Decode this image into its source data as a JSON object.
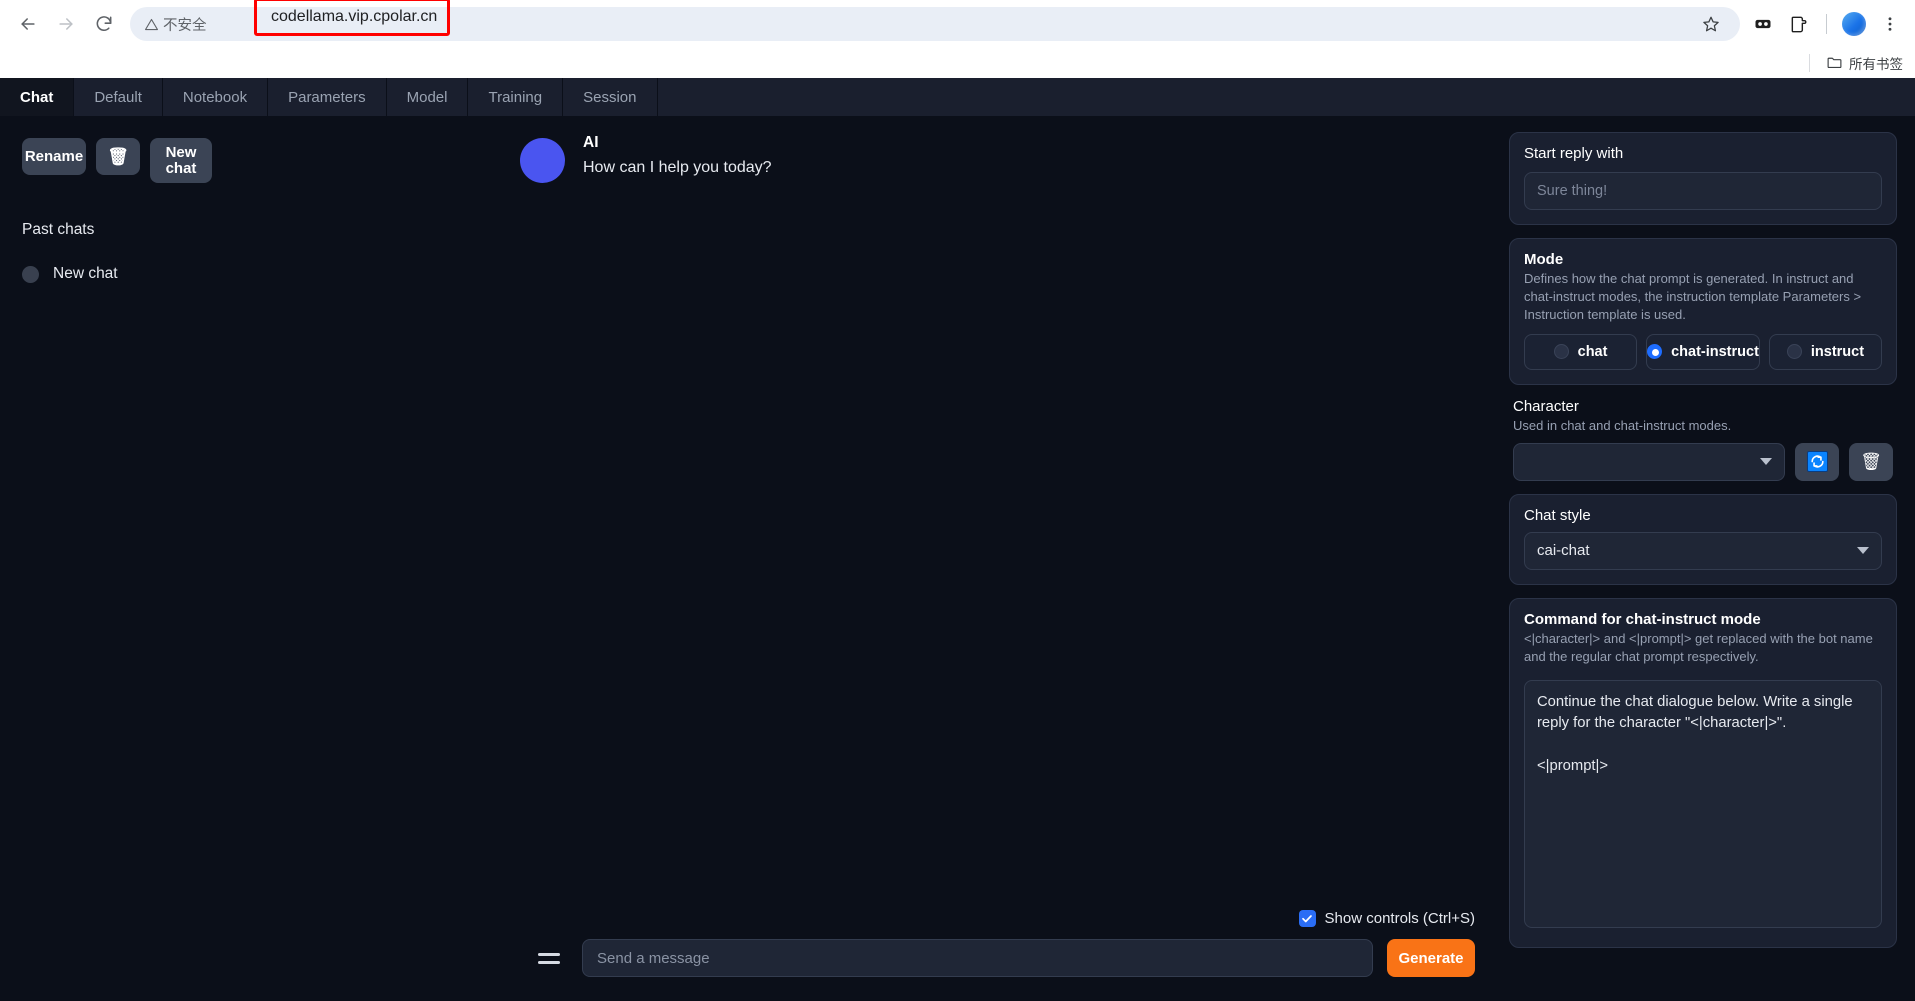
{
  "browser": {
    "back_icon": "back-arrow-icon",
    "forward_icon": "forward-arrow-icon",
    "reload_icon": "reload-icon",
    "security_label": "不安全",
    "url": "codellama.vip.cpolar.cn",
    "bookmark_star_icon": "star-icon",
    "extensions_icon": "extensions-icon",
    "split_icon": "split-view-icon",
    "menu_icon": "three-dot-menu-icon",
    "highlight_color": "#ff0000",
    "bookmarks": {
      "folder_icon": "folder-icon",
      "all_bookmarks_label": "所有书签"
    }
  },
  "tabs": [
    {
      "label": "Chat",
      "active": true
    },
    {
      "label": "Default",
      "active": false
    },
    {
      "label": "Notebook",
      "active": false
    },
    {
      "label": "Parameters",
      "active": false
    },
    {
      "label": "Model",
      "active": false
    },
    {
      "label": "Training",
      "active": false
    },
    {
      "label": "Session",
      "active": false
    }
  ],
  "sidebar": {
    "rename_label": "Rename",
    "delete_icon": "trash-icon",
    "new_chat_label": "New chat",
    "past_chats_label": "Past chats",
    "past_chats": [
      {
        "label": "New chat",
        "selected": false
      }
    ]
  },
  "chat": {
    "message": {
      "name": "AI",
      "text": "How can I help you today?",
      "avatar_color": "#4a55f0"
    },
    "show_controls_label": "Show controls (Ctrl+S)",
    "show_controls_checked": true,
    "menu_icon": "hamburger-menu-icon",
    "input_placeholder": "Send a message",
    "input_value": "",
    "generate_label": "Generate",
    "generate_color": "#f97316"
  },
  "controls": {
    "start_reply": {
      "title": "Start reply with",
      "placeholder": "Sure thing!",
      "value": ""
    },
    "mode": {
      "title": "Mode",
      "description": "Defines how the chat prompt is generated. In instruct and chat-instruct modes, the instruction template Parameters > Instruction template is used.",
      "options": [
        {
          "label": "chat",
          "selected": false
        },
        {
          "label": "chat-instruct",
          "selected": true
        },
        {
          "label": "instruct",
          "selected": false
        }
      ],
      "accent_color": "#1e6dff"
    },
    "character": {
      "title": "Character",
      "description": "Used in chat and chat-instruct modes.",
      "value": "",
      "refresh_icon": "refresh-icon",
      "delete_icon": "trash-icon"
    },
    "chat_style": {
      "title": "Chat style",
      "value": "cai-chat"
    },
    "command": {
      "title": "Command for chat-instruct mode",
      "description": "<|character|> and <|prompt|> get replaced with the bot name and the regular chat prompt respectively.",
      "value": "Continue the chat dialogue below. Write a single reply for the character \"<|character|>\".\n\n<|prompt|>"
    }
  }
}
